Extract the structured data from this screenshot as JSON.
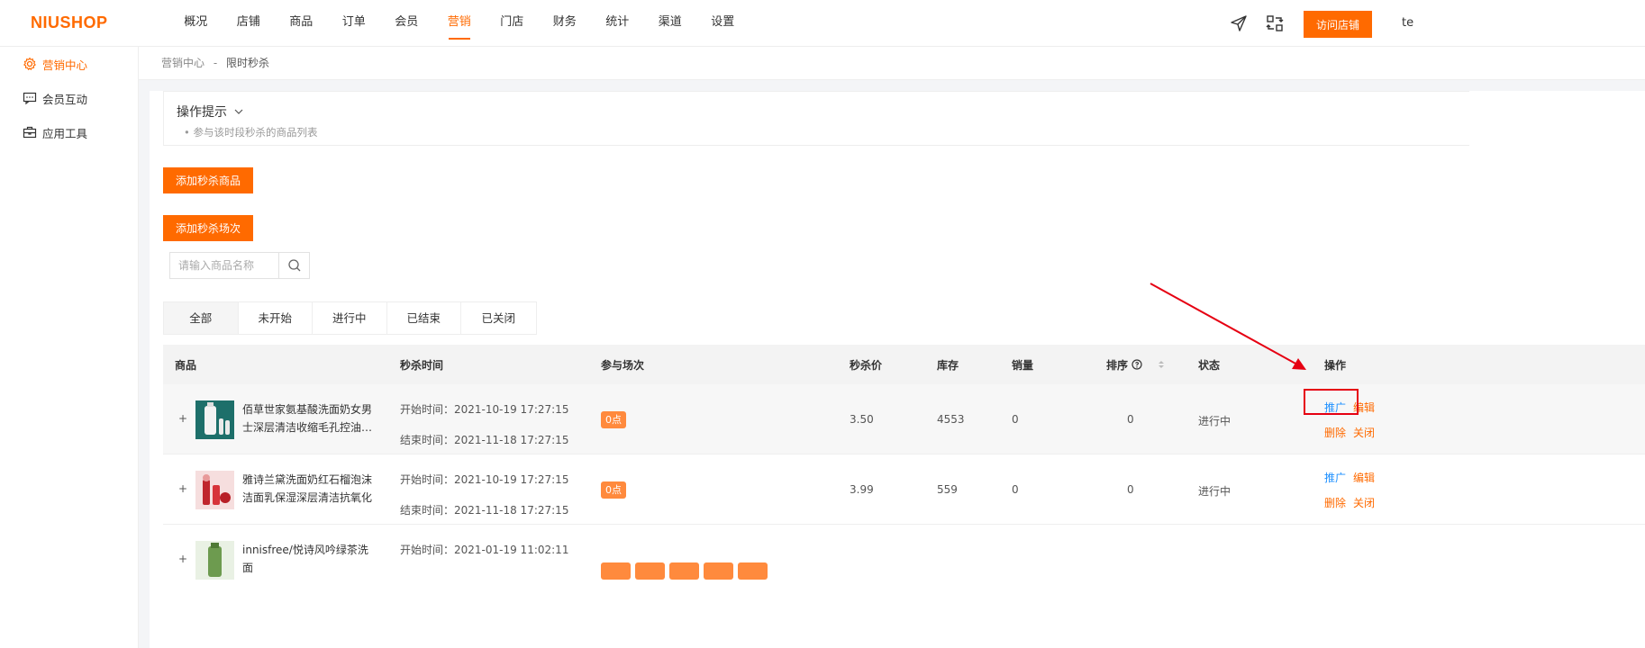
{
  "header": {
    "logo": "NIUSHOP",
    "nav": [
      "概况",
      "店铺",
      "商品",
      "订单",
      "会员",
      "营销",
      "门店",
      "财务",
      "统计",
      "渠道",
      "设置"
    ],
    "active_nav": 5,
    "visit_label": "访问店铺",
    "user": "te"
  },
  "sidebar": {
    "items": [
      {
        "label": "营销中心",
        "icon": "gear-icon",
        "active": true
      },
      {
        "label": "会员互动",
        "icon": "chat-icon",
        "active": false
      },
      {
        "label": "应用工具",
        "icon": "briefcase-icon",
        "active": false
      }
    ]
  },
  "breadcrumb": {
    "parent": "营销中心",
    "sep": "-",
    "current": "限时秒杀"
  },
  "tips": {
    "title": "操作提示",
    "items": [
      "参与该时段秒杀的商品列表"
    ]
  },
  "buttons": {
    "add_goods": "添加秒杀商品",
    "add_session": "添加秒杀场次"
  },
  "search": {
    "placeholder": "请输入商品名称"
  },
  "tabs": [
    {
      "label": "全部",
      "active": true
    },
    {
      "label": "未开始",
      "active": false
    },
    {
      "label": "进行中",
      "active": false
    },
    {
      "label": "已结束",
      "active": false
    },
    {
      "label": "已关闭",
      "active": false
    }
  ],
  "table": {
    "columns": [
      "商品",
      "秒杀时间",
      "参与场次",
      "秒杀价",
      "库存",
      "销量",
      "排序",
      "状态",
      "操作"
    ],
    "rows": [
      {
        "expand": "+",
        "name": "佰草世家氨基酸洗面奶女男士深层清洁收缩毛孔控油…",
        "start": "开始时间：2021-10-19 17:27:15",
        "end": "结束时间：2021-11-18 17:27:15",
        "slots": [
          "0点"
        ],
        "price": "3.50",
        "stock": "4553",
        "sales": "0",
        "sort": "0",
        "status": "进行中",
        "ops": [
          "推广",
          "编辑",
          "删除",
          "关闭"
        ]
      },
      {
        "expand": "+",
        "name": "雅诗兰黛洗面奶红石榴泡沫洁面乳保湿深层清洁抗氧化",
        "start": "开始时间：2021-10-19 17:27:15",
        "end": "结束时间：2021-11-18 17:27:15",
        "slots": [
          "0点"
        ],
        "price": "3.99",
        "stock": "559",
        "sales": "0",
        "sort": "0",
        "status": "进行中",
        "ops": [
          "推广",
          "编辑",
          "删除",
          "关闭"
        ]
      },
      {
        "expand": "+",
        "name": "innisfree/悦诗风吟绿茶洗面",
        "start": "开始时间：2021-01-19 11:02:11",
        "end": "",
        "slots": [
          "",
          "",
          "",
          "",
          ""
        ],
        "price": "",
        "stock": "",
        "sales": "",
        "sort": "",
        "status": "",
        "ops": []
      }
    ]
  },
  "colors": {
    "accent": "#ff6a00",
    "link": "#1e90ff",
    "annotation": "#e60012"
  }
}
